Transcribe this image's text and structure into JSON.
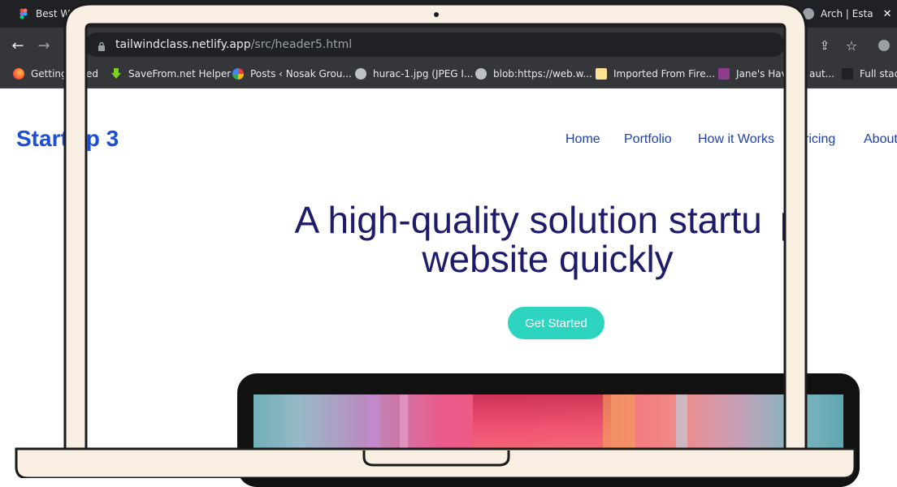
{
  "browser": {
    "tabs": [
      {
        "title": "Best We"
      },
      {
        "title": "Arch | Esta"
      }
    ],
    "close_glyph": "✕",
    "url_host": "tailwindclass.netlify.app",
    "url_path": "/src/header5.html",
    "bookmarks": [
      {
        "label": "Getting",
        "icon": "firefox-icon"
      },
      {
        "label": "ed",
        "icon": ""
      },
      {
        "label": "SaveFrom.net Helper",
        "icon": "download-arrow-icon"
      },
      {
        "label": "Posts ‹ Nosak Grou...",
        "icon": "wordpress-icon"
      },
      {
        "label": "hurac-1.jpg (JPEG I...",
        "icon": "globe-icon"
      },
      {
        "label": "blob:https://web.w...",
        "icon": "globe-icon"
      },
      {
        "label": "Imported From Fire...",
        "icon": "folder-icon"
      },
      {
        "label": "Jane's Have",
        "icon": "jane-icon"
      },
      {
        "label": "aut...",
        "icon": ""
      },
      {
        "label": "Full stack",
        "icon": "blank-icon"
      }
    ]
  },
  "site": {
    "logo": "Start",
    "logo_tail": "p 3",
    "nav": [
      "Home",
      "Portfolio",
      "How it Works",
      "ricing",
      "About"
    ],
    "hero_line1": "A high-quality solution startu",
    "hero_line1_tail": "p",
    "hero_line2": "website quickly",
    "cta": "Get Started"
  },
  "colors": {
    "brand_blue": "#1d4ed8",
    "nav_blue": "#1e40af",
    "hero_text": "#1e1b6b",
    "cta_teal": "#2dd4bf",
    "laptop_frame": "#f9efe3"
  }
}
